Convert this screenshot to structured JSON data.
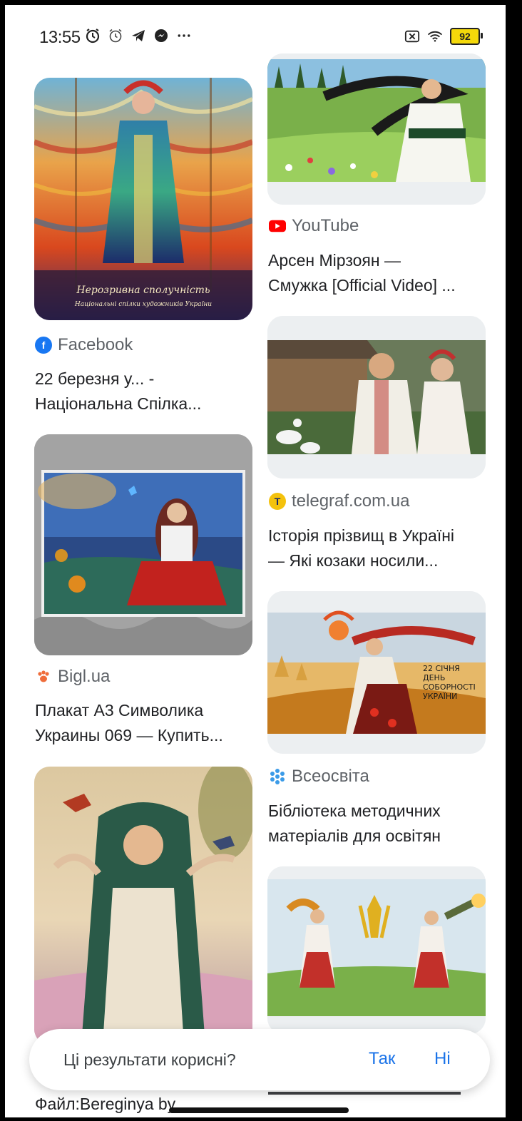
{
  "status_bar": {
    "time": "13:55",
    "battery": "92",
    "icons": [
      "alarm-icon",
      "alarm-outline-icon",
      "telegram-icon",
      "messenger-icon",
      "more-icon",
      "no-sim-icon",
      "wifi-icon",
      "battery-icon"
    ]
  },
  "results": [
    {
      "source": "Facebook",
      "source_icon": "facebook-icon",
      "title": [
        "22 березня у... -",
        "Національна Спілка..."
      ]
    },
    {
      "source": "YouTube",
      "source_icon": "youtube-icon",
      "title": [
        "Арсен Мірзоян —",
        "Смужка [Official Video] ..."
      ]
    },
    {
      "source": "telegraf.com.ua",
      "source_icon": "telegraf-icon",
      "title": [
        "Історія прізвищ в Україні",
        "— Які козаки носили..."
      ]
    },
    {
      "source": "Bigl.ua",
      "source_icon": "paw-icon",
      "title": [
        "Плакат А3 Символика",
        "Украины 069 — Купить..."
      ]
    },
    {
      "source": "Всеосвіта",
      "source_icon": "snowflake-icon",
      "title": [
        "Бібліотека методичних",
        "матеріалів для освітян"
      ]
    }
  ],
  "image_texts": {
    "poster_line1": "Нерозривна сполучність",
    "poster_line2": "Національні спілки художників України",
    "day_line1": "22 СІЧНЯ",
    "day_line2": "ДЕНЬ",
    "day_line3": "СОБОРНОСТІ",
    "day_line4": "УКРАЇНИ"
  },
  "peek_left": "Файл:Bereginya by",
  "feedback": {
    "question": "Ці результати корисні?",
    "yes": "Так",
    "no": "Ні"
  },
  "colors": {
    "link": "#1a73e8",
    "facebook": "#1877f2",
    "youtube": "#ff0000",
    "telegraf": "#f4c20d",
    "bigl": "#ef6c3a",
    "vseosvita": "#3b9be8"
  }
}
